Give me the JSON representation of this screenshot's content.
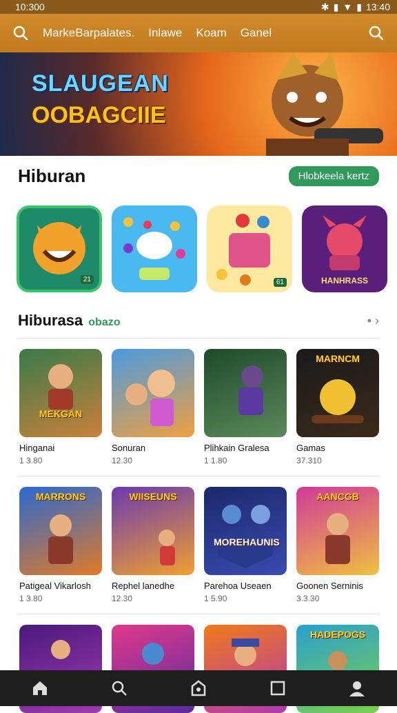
{
  "status": {
    "time_left": "10:300",
    "time_right": "13:40"
  },
  "topbar": {
    "nav": [
      "MarkeBarpalates.",
      "Inlawe",
      "Koam",
      "Ganel"
    ]
  },
  "banner": {
    "line1": "SLAUGEAN",
    "line2": "OOBAGCIIE"
  },
  "section1": {
    "title": "Hiburan",
    "action": "Hlobkeela kertz",
    "tiles": [
      {
        "label": "",
        "badge": "21",
        "color": "#2a9a4a"
      },
      {
        "label": "",
        "badge": "",
        "color": "#4ab9f0"
      },
      {
        "label": "",
        "badge": "61",
        "color": "#ffe27a"
      },
      {
        "label": "HANHRASS",
        "badge": "",
        "color": "#6a2a8a"
      }
    ]
  },
  "section2": {
    "title": "Hiburasa",
    "subtitle": "obazo",
    "row1": [
      {
        "name": "Hinganai",
        "meta": "1 3.80",
        "art": "MEKGAN",
        "c1": "#3a7a4a",
        "c2": "#c9813a"
      },
      {
        "name": "Sonuran",
        "meta": "12.30",
        "art": "",
        "c1": "#4a9ae0",
        "c2": "#f0a040"
      },
      {
        "name": "Plihkain Gralesa",
        "meta": "1 1.80",
        "art": "",
        "c1": "#1f4a2a",
        "c2": "#5a8a5a"
      },
      {
        "name": "Gamas",
        "meta": "37.310",
        "art": "MARNCM",
        "c1": "#1a1a1a",
        "c2": "#3a2a1a"
      }
    ],
    "row2": [
      {
        "name": "Patigeal Vikarlosh",
        "meta": "1 3.80",
        "art": "MARRONS",
        "c1": "#2a6ad0",
        "c2": "#e07a2a"
      },
      {
        "name": "Rephel lanedhe",
        "meta": "12.30",
        "art": "WIISEUNS",
        "c1": "#6a3ab0",
        "c2": "#f0a030"
      },
      {
        "name": "Parehoa Useaen",
        "meta": "1 5.90",
        "art": "MOREHAUNIS",
        "c1": "#1a2a6a",
        "c2": "#3a4ab0"
      },
      {
        "name": "Goonen Serninis",
        "meta": "3.3.30",
        "art": "AANCGB",
        "c1": "#d03a9a",
        "c2": "#f0c040"
      }
    ],
    "row3": [
      {
        "art": "",
        "c1": "#4a1a7a",
        "c2": "#a03ab0"
      },
      {
        "art": "",
        "c1": "#e03a8a",
        "c2": "#5a2aa0"
      },
      {
        "art": "",
        "c1": "#f07a1a",
        "c2": "#b03ab0"
      },
      {
        "art": "HADEPOGS",
        "c1": "#2aa0d0",
        "c2": "#7ad04a"
      }
    ]
  },
  "bottomnav": [
    "home-icon",
    "search-icon",
    "shield-icon",
    "square-icon",
    "profile-icon"
  ]
}
